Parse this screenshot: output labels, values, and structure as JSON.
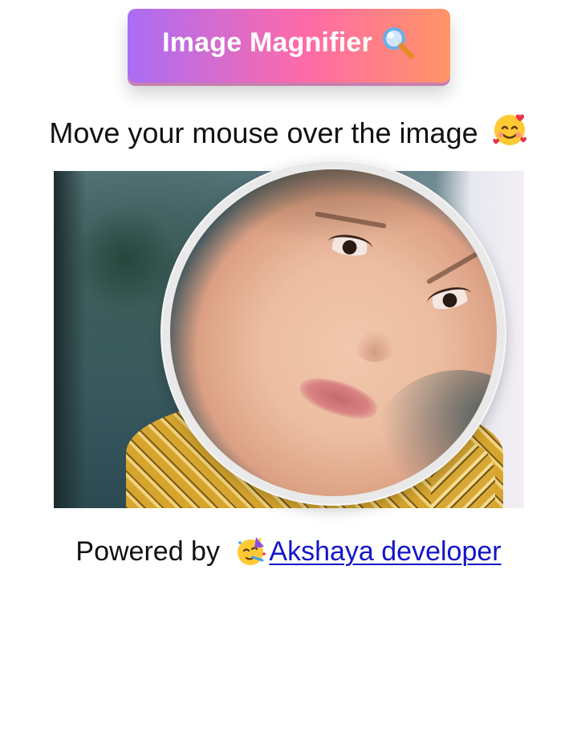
{
  "header": {
    "title": "Image Magnifier",
    "title_icon": "magnifying-glass-icon"
  },
  "instruction": {
    "text": "Move your mouse over the image",
    "emoji_icon": "smiling-face-with-hearts-icon"
  },
  "image": {
    "alt_description_visible": false
  },
  "footer": {
    "prefix": "Powered by",
    "emoji_icon": "partying-face-icon",
    "link_text": "Akshaya developer",
    "link_color": "#1515c8"
  },
  "colors": {
    "gradient_start": "#a96df5",
    "gradient_mid": "#ff6aa8",
    "gradient_end": "#ff9566",
    "magnifier_border": "#e9e9e9"
  }
}
